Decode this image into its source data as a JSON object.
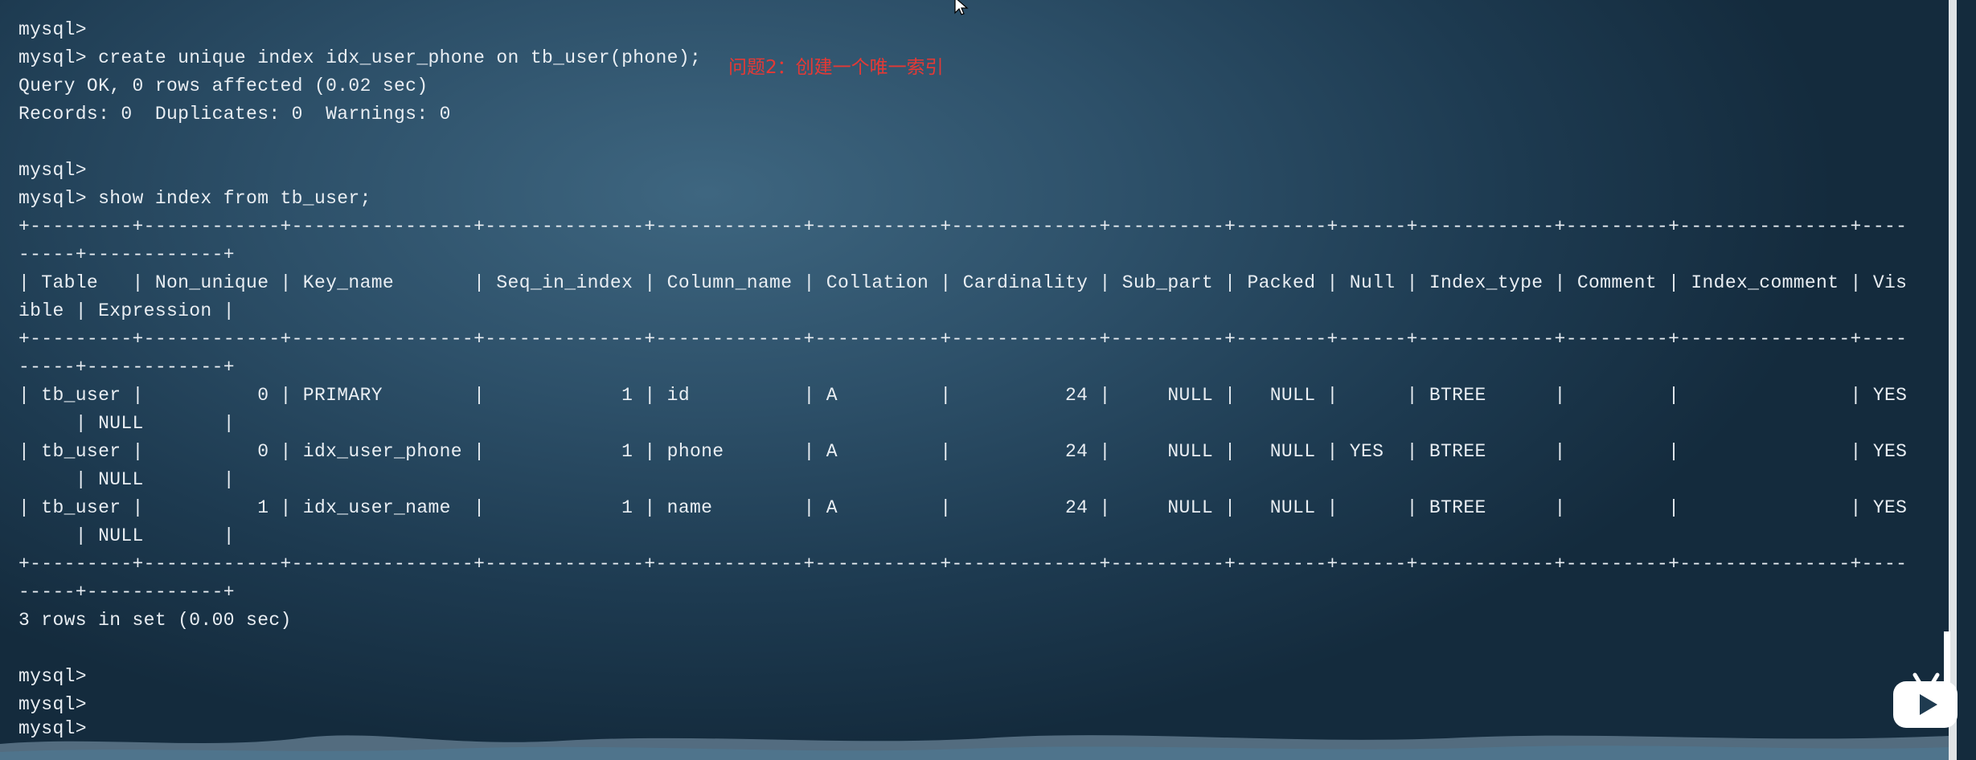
{
  "terminal": {
    "lines": [
      "mysql>",
      "mysql> create unique index idx_user_phone on tb_user(phone);",
      "Query OK, 0 rows affected (0.02 sec)",
      "Records: 0  Duplicates: 0  Warnings: 0",
      "",
      "mysql>",
      "mysql> show index from tb_user;",
      "+---------+------------+----------------+--------------+-------------+-----------+-------------+----------+--------+------+------------+---------+---------------+----",
      "-----+------------+",
      "| Table   | Non_unique | Key_name       | Seq_in_index | Column_name | Collation | Cardinality | Sub_part | Packed | Null | Index_type | Comment | Index_comment | Vis",
      "ible | Expression |",
      "+---------+------------+----------------+--------------+-------------+-----------+-------------+----------+--------+------+------------+---------+---------------+----",
      "-----+------------+",
      "| tb_user |          0 | PRIMARY        |            1 | id          | A         |          24 |     NULL |   NULL |      | BTREE      |         |               | YES",
      "     | NULL       |",
      "| tb_user |          0 | idx_user_phone |            1 | phone       | A         |          24 |     NULL |   NULL | YES  | BTREE      |         |               | YES",
      "     | NULL       |",
      "| tb_user |          1 | idx_user_name  |            1 | name        | A         |          24 |     NULL |   NULL |      | BTREE      |         |               | YES",
      "     | NULL       |",
      "+---------+------------+----------------+--------------+-------------+-----------+-------------+----------+--------+------+------------+---------+---------------+----",
      "-----+------------+",
      "3 rows in set (0.00 sec)",
      "",
      "mysql>",
      "mysql>",
      "mysql>"
    ]
  },
  "annotation": {
    "text": "问题2：创建一个唯一索引",
    "color": "#e53935"
  },
  "icons": {
    "cursor": "mouse-pointer-icon",
    "player": "bilibili-tv-icon"
  },
  "colors": {
    "terminal_text": "#e9eef3",
    "background": "#2d5069"
  }
}
